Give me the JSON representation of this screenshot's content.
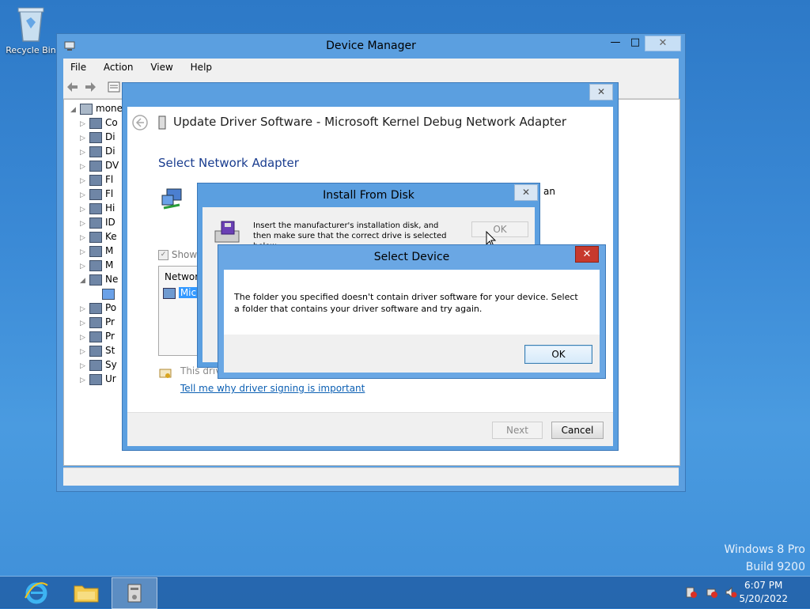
{
  "desktop": {
    "recycle_bin_label": "Recycle Bin",
    "watermark_line1": "Windows 8 Pro",
    "watermark_line2": "Build 9200"
  },
  "device_manager": {
    "title": "Device Manager",
    "menu": [
      "File",
      "Action",
      "View",
      "Help"
    ],
    "tree_root": "mone",
    "tree_items": [
      "Co",
      "Di",
      "Di",
      "DV",
      "Fl",
      "Fl",
      "Hi",
      "ID",
      "Ke",
      "M",
      "M",
      "Ne",
      "",
      "Po",
      "Pr",
      "Pr",
      "St",
      "Sy",
      "Ur"
    ]
  },
  "update_driver": {
    "title": "Update Driver Software - Microsoft Kernel Debug Network Adapter",
    "heading": "Select Network Adapter",
    "partial_text": "an",
    "show_compatible": "Show",
    "list_header": "Networ",
    "list_item": "Micr",
    "signed_text": "This driv",
    "signing_link": "Tell me why driver signing is important",
    "next_label": "Next",
    "cancel_label": "Cancel"
  },
  "install_from_disk": {
    "title": "Install From Disk",
    "instruction": "Insert the manufacturer's installation disk, and then make sure that the correct drive is selected below.",
    "ok_label": "OK"
  },
  "select_device": {
    "title": "Select Device",
    "message": "The folder you specified doesn't contain driver software for your device. Select a folder that contains your driver software and try again.",
    "ok_label": "OK"
  },
  "taskbar": {
    "time": "6:07 PM",
    "date": "5/20/2022"
  }
}
